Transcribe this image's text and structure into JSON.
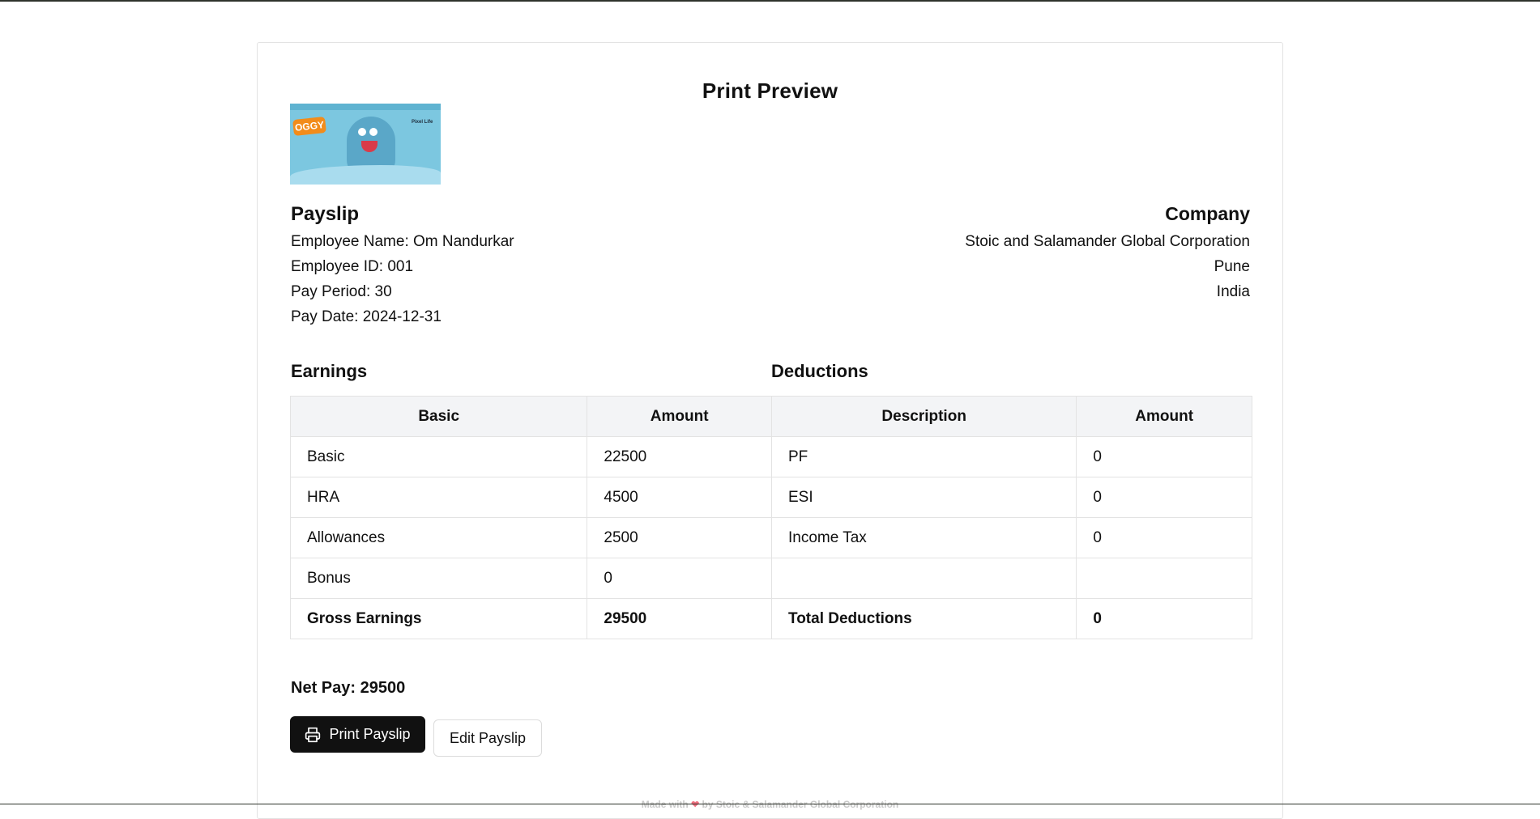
{
  "preview": {
    "title": "Print Preview"
  },
  "logo": {
    "wordmark": "OGGY",
    "tag": "Pixel Life"
  },
  "payslip": {
    "heading": "Payslip",
    "employee_name": "Employee Name: Om Nandurkar",
    "employee_id": "Employee ID: 001",
    "pay_period": "Pay Period: 30",
    "pay_date": "Pay Date: 2024-12-31"
  },
  "company": {
    "heading": "Company",
    "name": "Stoic and Salamander Global Corporation",
    "city": "Pune",
    "country": "India"
  },
  "earnings": {
    "heading": "Earnings",
    "columns": [
      "Basic",
      "Amount"
    ],
    "rows": [
      [
        "Basic",
        "22500"
      ],
      [
        "HRA",
        "4500"
      ],
      [
        "Allowances",
        "2500"
      ],
      [
        "Bonus",
        "0"
      ]
    ],
    "total": [
      "Gross Earnings",
      "29500"
    ]
  },
  "deductions": {
    "heading": "Deductions",
    "columns": [
      "Description",
      "Amount"
    ],
    "rows": [
      [
        "PF",
        "0"
      ],
      [
        "ESI",
        "0"
      ],
      [
        "Income Tax",
        "0"
      ],
      [
        "",
        ""
      ]
    ],
    "total": [
      "Total Deductions",
      "0"
    ]
  },
  "net_pay": "Net Pay: 29500",
  "actions": {
    "print_label": "Print Payslip",
    "edit_label": "Edit Payslip"
  },
  "footer": {
    "made_with": "Made with",
    "heart_icon": "heart-icon",
    "by": "by Stoic & Salamander Global Corporation"
  },
  "colors": {
    "primary_button": "#111111",
    "header_row": "#f3f4f6",
    "border": "#e3e3e3",
    "heart": "#f07080"
  }
}
